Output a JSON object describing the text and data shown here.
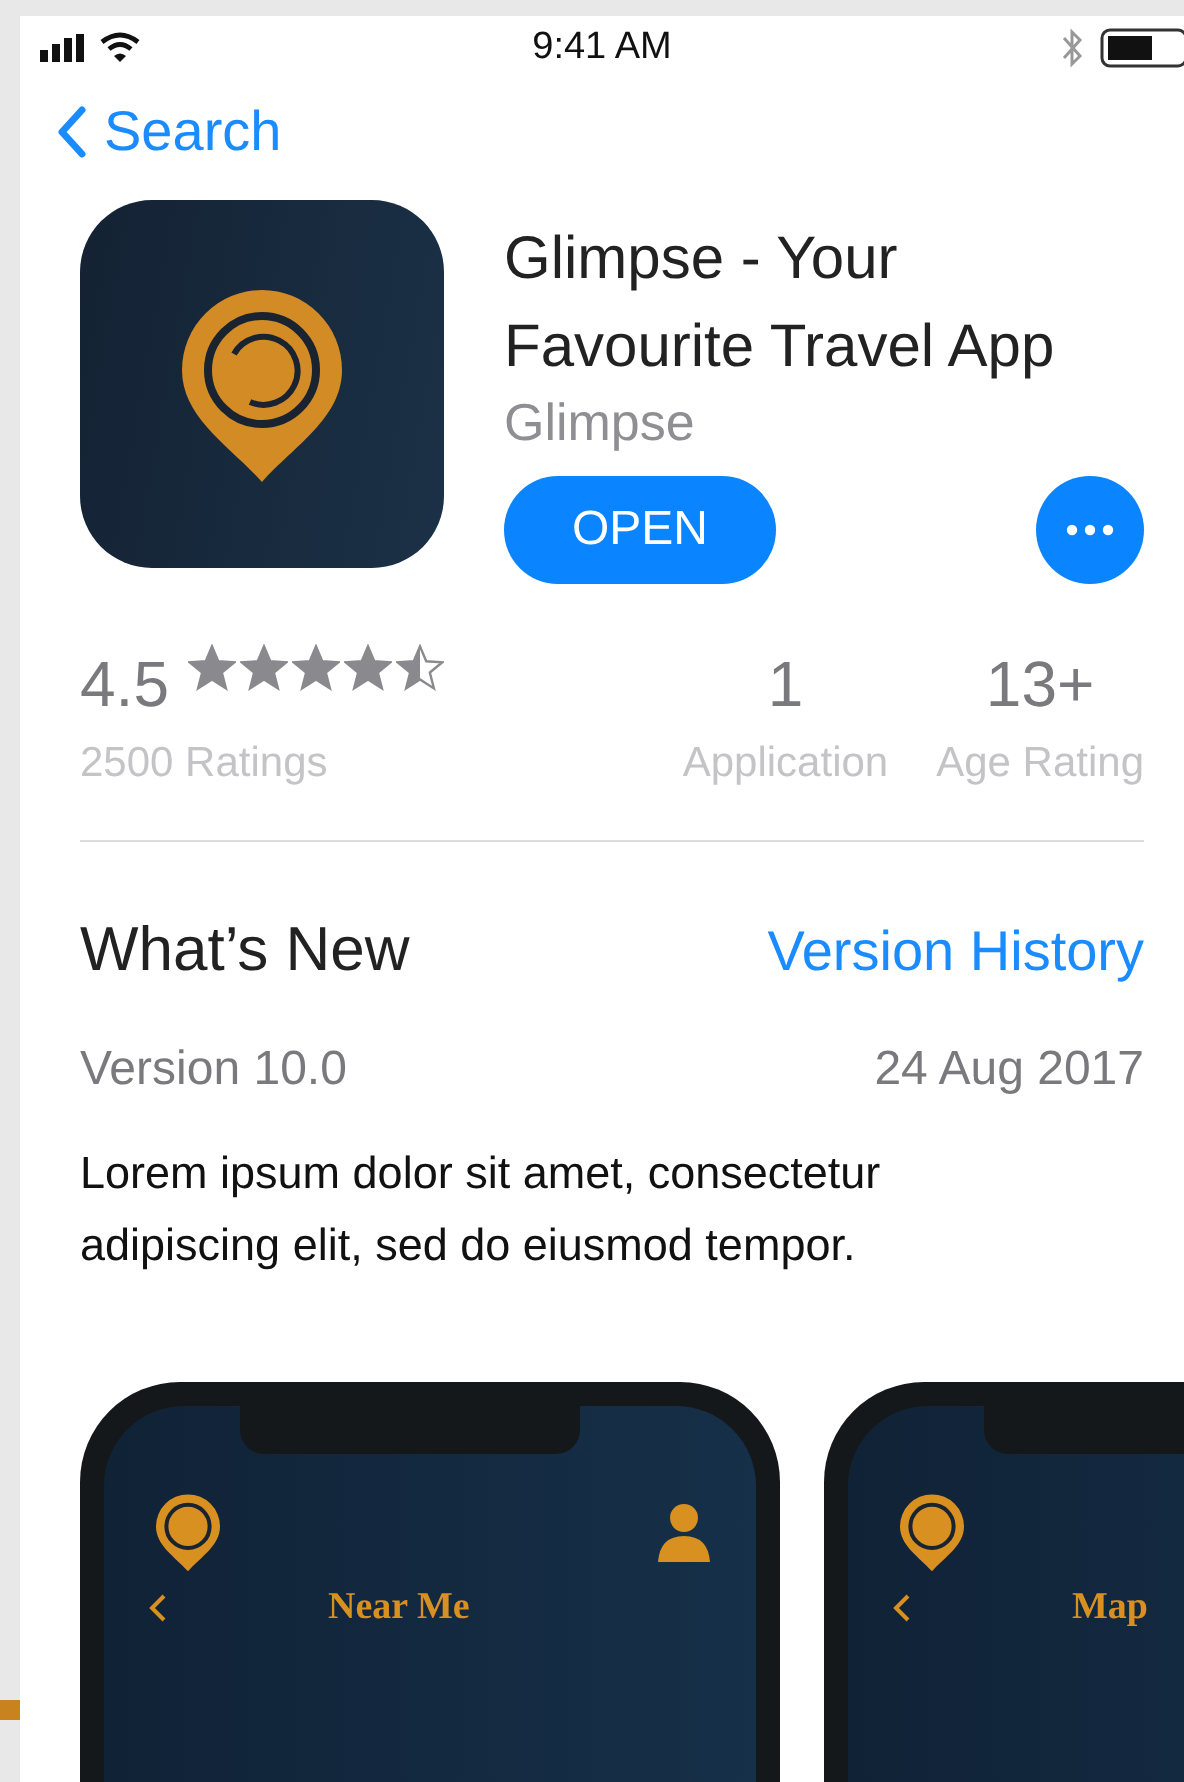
{
  "status_bar": {
    "time": "9:41 AM"
  },
  "nav": {
    "back_label": "Search"
  },
  "app": {
    "title": "Glimpse - Your Favourite Travel App",
    "developer": "Glimpse",
    "open_button": "OPEN"
  },
  "ratings": {
    "score": "4.5",
    "stars": 4.5,
    "count_label": "2500 Ratings"
  },
  "stats": [
    {
      "value": "1",
      "label": "Application"
    },
    {
      "value": "13+",
      "label": "Age Rating"
    }
  ],
  "whats_new": {
    "title": "What’s New",
    "link": "Version History",
    "version": "Version 10.0",
    "date": "24 Aug 2017",
    "notes": "Lorem ipsum dolor sit amet, consectetur adipiscing elit, sed do eiusmod tempor."
  },
  "screenshots": [
    {
      "title": "Near Me"
    },
    {
      "title": "Map"
    }
  ]
}
